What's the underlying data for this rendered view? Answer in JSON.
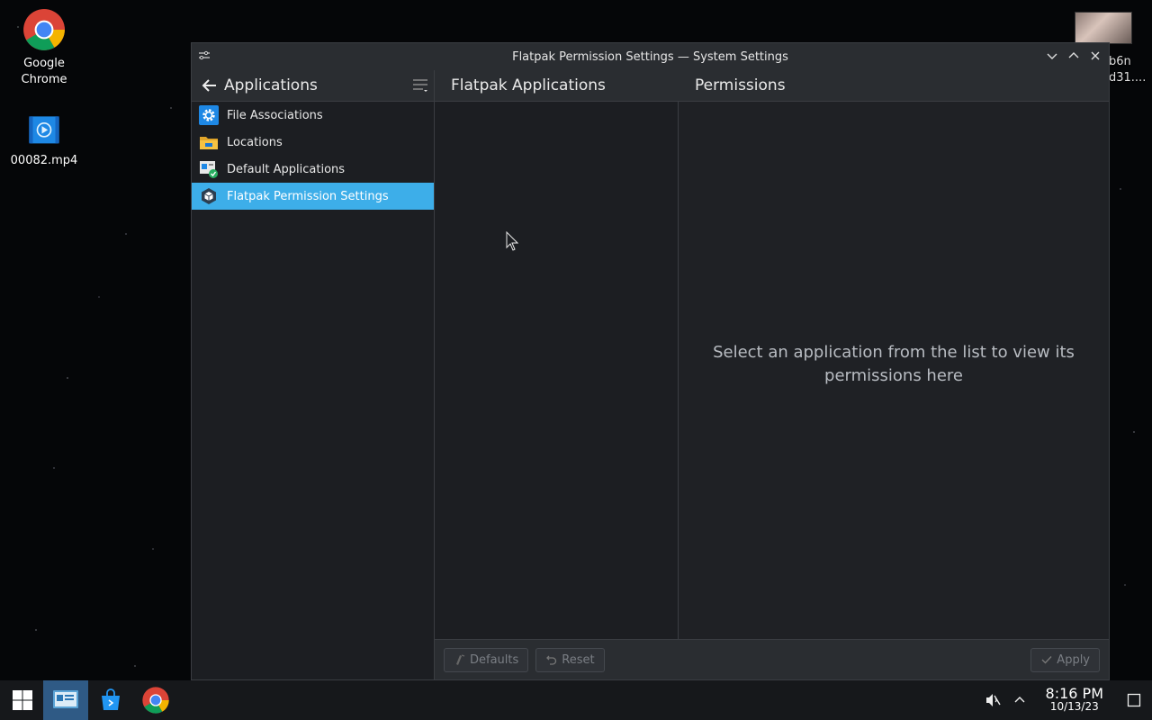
{
  "desktop": {
    "icons": [
      {
        "label": "Google Chrome"
      },
      {
        "label": "00082.mp4"
      }
    ],
    "topright_label": "b6n\nd31...."
  },
  "window": {
    "title": "Flatpak Permission Settings — System Settings",
    "sidebar_header": "Applications",
    "apps_header": "Flatpak Applications",
    "permissions_header": "Permissions",
    "sidebar_items": [
      {
        "label": "File Associations",
        "icon": "gear-icon"
      },
      {
        "label": "Locations",
        "icon": "folder-icon"
      },
      {
        "label": "Default Applications",
        "icon": "default-apps-icon"
      },
      {
        "label": "Flatpak Permission Settings",
        "icon": "flatpak-icon",
        "selected": true
      }
    ],
    "empty_message": "Select an application from the list to view its permissions here",
    "footer": {
      "defaults_label": "Defaults",
      "reset_label": "Reset",
      "apply_label": "Apply"
    }
  },
  "taskbar": {
    "time": "8:16 PM",
    "date": "10/13/23"
  },
  "colors": {
    "accent": "#3daee9",
    "window_bg": "#1c1e22",
    "header_bg": "#2a2d31",
    "taskbar_active": "#2f5a85"
  }
}
